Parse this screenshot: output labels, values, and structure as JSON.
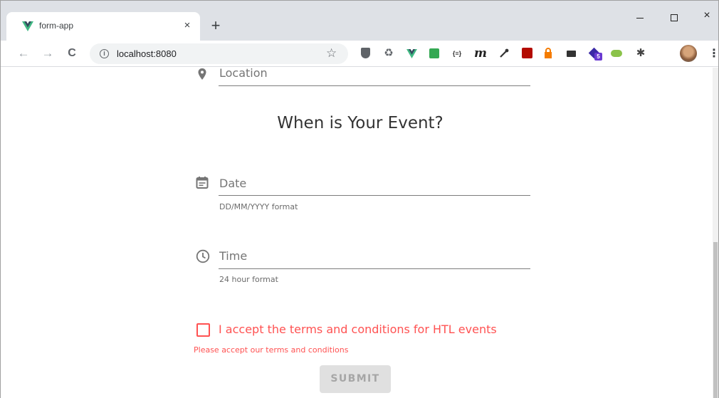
{
  "browser": {
    "tab_title": "form-app",
    "tab_close": "×",
    "new_tab": "+",
    "url": "localhost:8080",
    "window_controls": {
      "minimize": "minimize",
      "maximize": "maximize",
      "close": "×"
    },
    "nav": {
      "back": "←",
      "forward": "→",
      "reload": "C"
    },
    "extensions": [
      "ublock-icon",
      "recycle-icon",
      "vue-devtools-icon",
      "green-save-icon",
      "json-viewer-icon",
      "m-icon",
      "eyedropper-icon",
      "acrobat-icon",
      "lock-badge-icon",
      "video-icon",
      "stack-icon",
      "toggle-icon",
      "puzzle-icon"
    ],
    "ext_badge": "5",
    "json_ext_text": "{≡}",
    "m_ext_text": "m"
  },
  "form": {
    "location_label": "Location",
    "section_title": "When is Your Event?",
    "date_label": "Date",
    "date_hint": "DD/MM/YYYY format",
    "time_label": "Time",
    "time_hint": "24 hour format",
    "terms_label": "I accept the terms and conditions for HTL events",
    "terms_error": "Please accept our terms and conditions",
    "submit_label": "SUBMIT"
  },
  "colors": {
    "error": "#ff5252",
    "label": "#757575",
    "submit_disabled_bg": "#e0e0e0",
    "vue_green": "#41b883"
  }
}
